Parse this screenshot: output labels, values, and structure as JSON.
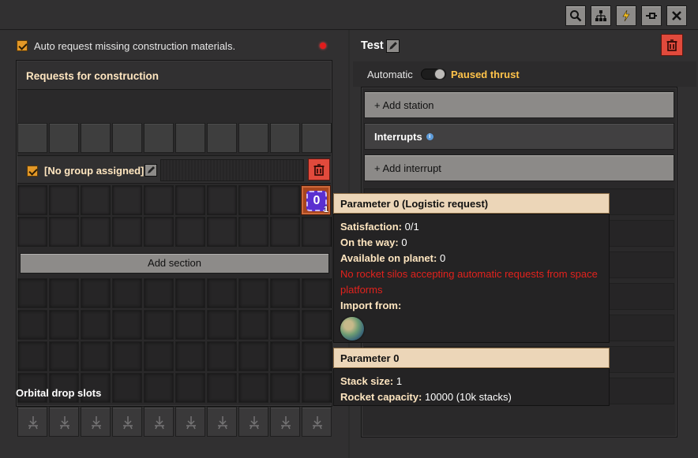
{
  "window": {
    "top_buttons": [
      {
        "name": "search-button",
        "icon": "magnifier-icon"
      },
      {
        "name": "logistic-network-button",
        "icon": "network-tree-icon"
      },
      {
        "name": "electric-network-button",
        "icon": "lightning-icon"
      },
      {
        "name": "pin-button",
        "icon": "pin-icon"
      },
      {
        "name": "close-button",
        "icon": "close-icon"
      }
    ]
  },
  "left": {
    "auto_request_label": "Auto request missing construction materials.",
    "status_dot_color": "#e21c1c",
    "requests_title": "Requests for construction",
    "group_label": "[No group assigned]",
    "slot_item_label": "0",
    "slot_item_count": "1",
    "add_section": "Add section",
    "orbital_title": "Orbital drop slots"
  },
  "right": {
    "title": "Test",
    "mode_label": "Automatic",
    "status_label": "Paused thrust",
    "add_station": "+ Add station",
    "interrupts": "Interrupts",
    "add_interrupt": "+ Add interrupt"
  },
  "tooltip": {
    "header1": "Parameter 0 (Logistic request)",
    "satisfaction_key": "Satisfaction:",
    "satisfaction_val": "0/1",
    "on_the_way_key": "On the way:",
    "on_the_way_val": "0",
    "available_key": "Available on planet:",
    "available_val": "0",
    "warning": "No rocket silos accepting automatic requests from space platforms",
    "import_key": "Import from:",
    "header2": "Parameter 0",
    "stack_key": "Stack size:",
    "stack_val": "1",
    "capacity_key": "Rocket capacity:",
    "capacity_val": "10000 (10k stacks)"
  },
  "colors": {
    "accent_orange": "#e39827",
    "danger_red": "#e14a3c",
    "tooltip_header": "#ecd6b8",
    "status_text": "#ffc34a"
  }
}
